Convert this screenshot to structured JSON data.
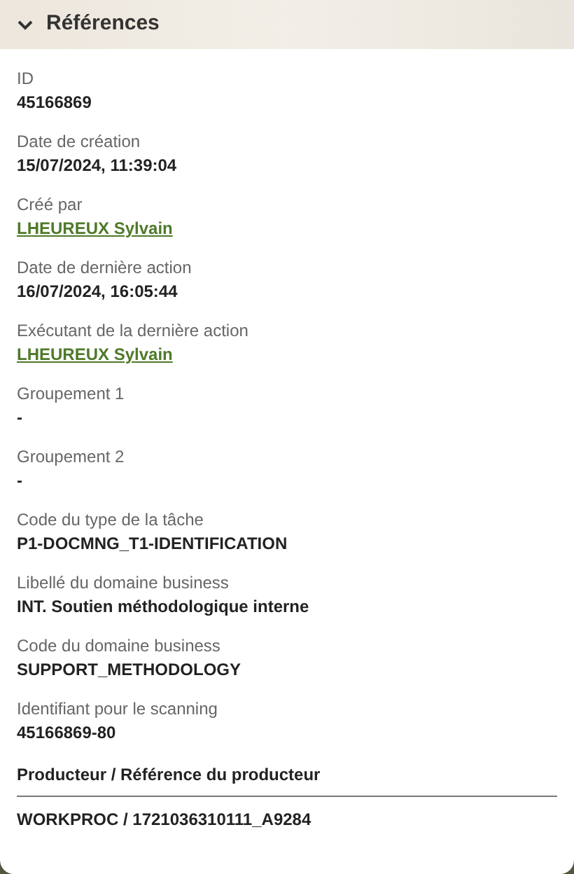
{
  "panel": {
    "title": "Références",
    "expanded": true
  },
  "fields": [
    {
      "label": "ID",
      "value": "45166869",
      "kind": "text"
    },
    {
      "label": "Date de création",
      "value": "15/07/2024, 11:39:04",
      "kind": "text"
    },
    {
      "label": "Créé par",
      "value": "LHEUREUX Sylvain",
      "kind": "link"
    },
    {
      "label": "Date de dernière action",
      "value": "16/07/2024, 16:05:44",
      "kind": "text"
    },
    {
      "label": "Exécutant de la dernière action",
      "value": "LHEUREUX Sylvain",
      "kind": "link"
    },
    {
      "label": "Groupement 1",
      "value": "-",
      "kind": "text"
    },
    {
      "label": "Groupement 2",
      "value": "-",
      "kind": "text"
    },
    {
      "label": "Code du type de la tâche",
      "value": "P1-DOCMNG_T1-IDENTIFICATION",
      "kind": "text"
    },
    {
      "label": "Libellé du domaine business",
      "value": "INT. Soutien méthodologique interne",
      "kind": "text"
    },
    {
      "label": "Code du domaine business",
      "value": "SUPPORT_METHODOLOGY",
      "kind": "text"
    },
    {
      "label": "Identifiant pour le scanning",
      "value": "45166869-80",
      "kind": "text"
    }
  ],
  "producer": {
    "heading": "Producteur / Référence du producteur",
    "value": "WORKPROC / 1721036310111_A9284"
  }
}
